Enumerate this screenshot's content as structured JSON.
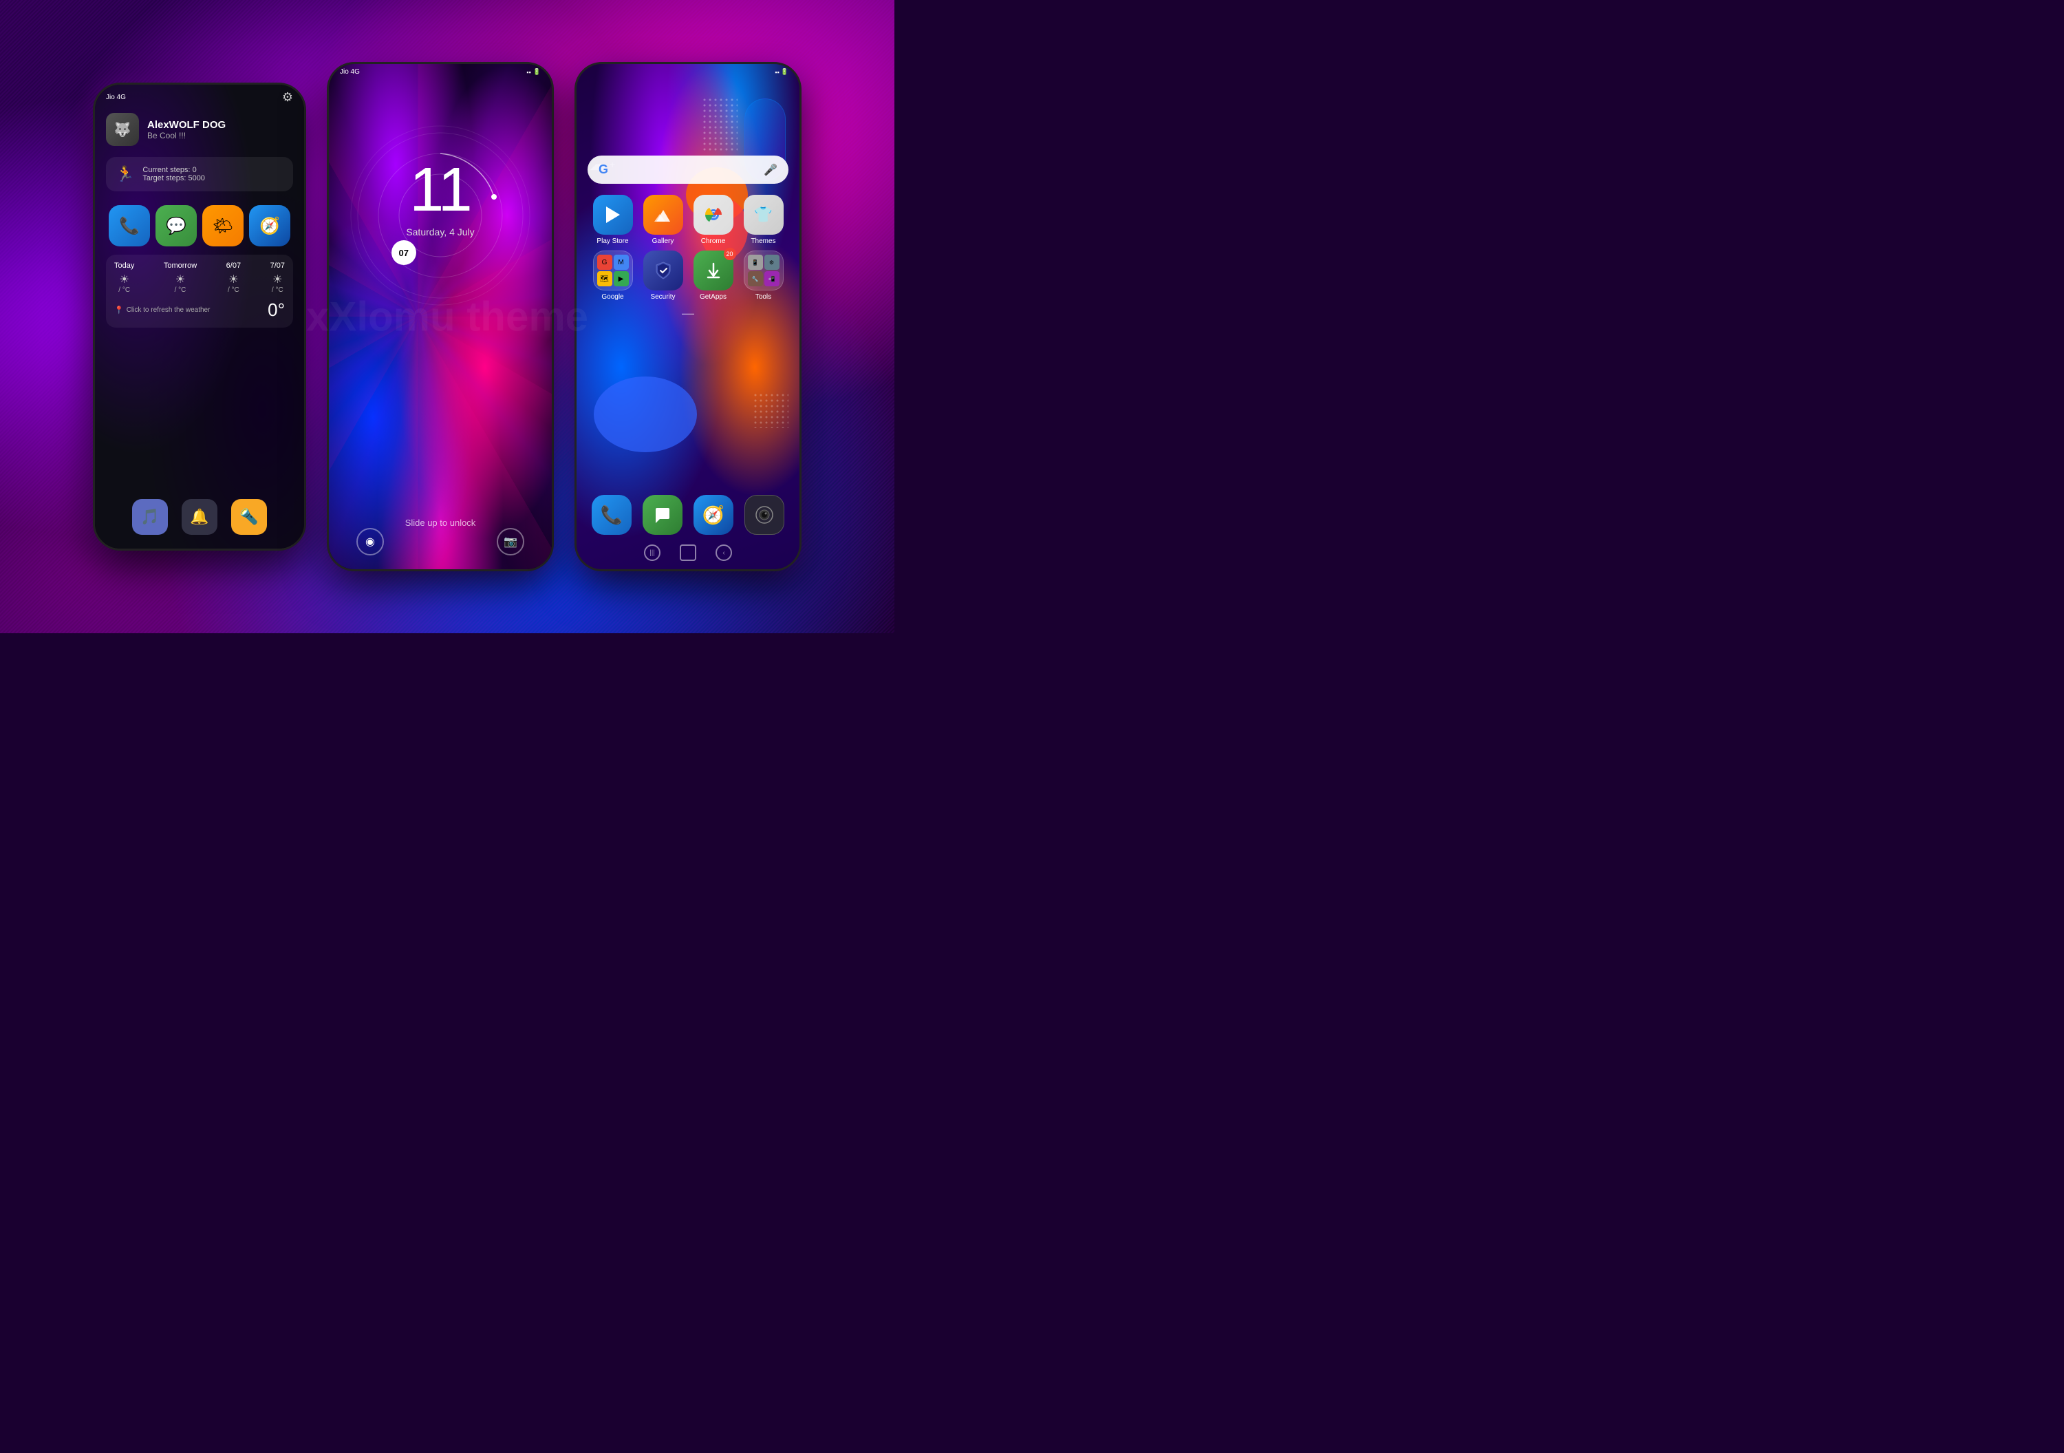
{
  "background": {
    "primary_color": "#1a0030",
    "accent1": "#9b00ff",
    "accent2": "#ff00aa",
    "accent3": "#0044ff"
  },
  "phone_left": {
    "status_bar": {
      "carrier": "Jio 4G",
      "signal_icons": "▪▪▪",
      "battery": "⬛"
    },
    "profile": {
      "name": "AlexWOLF DOG",
      "subtitle": "Be Cool !!!",
      "avatar_emoji": "🐺"
    },
    "steps": {
      "current_label": "Current steps:",
      "current_value": "0",
      "target_label": "Target steps:",
      "target_value": "5000"
    },
    "apps": [
      {
        "icon": "📞",
        "class": "app-phone-icon",
        "label": "Phone"
      },
      {
        "icon": "💬",
        "class": "app-msg-icon",
        "label": "Messages"
      },
      {
        "icon": "🌤",
        "class": "app-weather-icon",
        "label": "Weather"
      },
      {
        "icon": "🧭",
        "class": "app-compass-icon",
        "label": "Compass"
      }
    ],
    "weather": {
      "days": [
        "Today",
        "Tomorrow",
        "6/07",
        "7/07"
      ],
      "refresh_text": "Click to refresh the weather",
      "temperature": "0°"
    },
    "dock": [
      {
        "icon": "🎵",
        "class": "dock-music"
      },
      {
        "icon": "🔔",
        "class": "dock-bell"
      },
      {
        "icon": "🔦",
        "class": "dock-flashlight"
      }
    ]
  },
  "phone_center": {
    "status_bar": {
      "carrier": "Jio 4G"
    },
    "lock_screen": {
      "hour": "11",
      "minute": "07",
      "date": "Saturday, 4 July",
      "slide_text": "Slide up to unlock"
    }
  },
  "phone_right": {
    "status_bar": {
      "carrier": "",
      "battery": "⬛"
    },
    "search_bar": {
      "placeholder": ""
    },
    "apps_row1": [
      {
        "label": "Play Store",
        "class": "app-playstore",
        "icon": "▶",
        "badge": ""
      },
      {
        "label": "Gallery",
        "class": "app-gallery",
        "icon": "🖼",
        "badge": ""
      },
      {
        "label": "Chrome",
        "class": "app-chrome",
        "icon": "◎",
        "badge": ""
      },
      {
        "label": "Themes",
        "class": "app-themes",
        "icon": "👕",
        "badge": ""
      }
    ],
    "apps_row2": [
      {
        "label": "Google",
        "class": "app-google-folder",
        "icon": "folder",
        "badge": ""
      },
      {
        "label": "Security",
        "class": "app-security",
        "icon": "🛡",
        "badge": ""
      },
      {
        "label": "GetApps",
        "class": "app-getapps",
        "icon": "⬇",
        "badge": "20"
      },
      {
        "label": "Tools",
        "class": "app-tools",
        "icon": "folder2",
        "badge": ""
      }
    ],
    "dock": [
      {
        "icon": "📞",
        "class": "rdock-phone"
      },
      {
        "icon": "💬",
        "class": "rdock-msg"
      },
      {
        "icon": "🧭",
        "class": "rdock-compass"
      },
      {
        "icon": "⚫",
        "class": "rdock-cam"
      }
    ],
    "page_indicator": "—"
  },
  "watermark": "xXlomu theme"
}
